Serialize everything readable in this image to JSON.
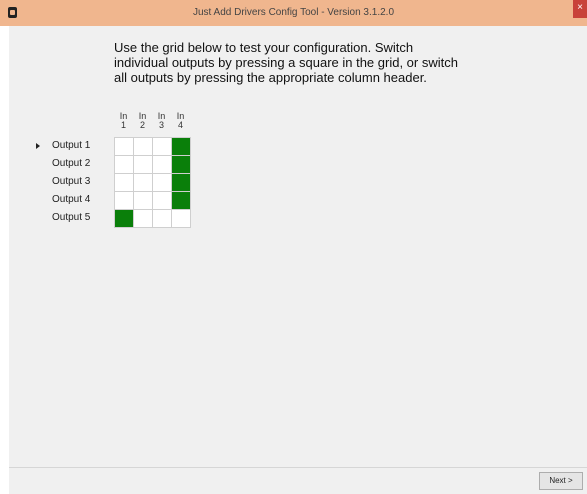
{
  "window": {
    "title": "Just Add Drivers Config Tool - Version 3.1.2.0",
    "close_glyph": "×"
  },
  "instructions": "Use the grid below to test your configuration. Switch\nindividual outputs by pressing a square in the grid, or switch\nall outputs by pressing the appropriate column header.",
  "grid": {
    "columns": [
      {
        "line1": "In",
        "line2": "1"
      },
      {
        "line1": "In",
        "line2": "2"
      },
      {
        "line1": "In",
        "line2": "3"
      },
      {
        "line1": "In",
        "line2": "4"
      }
    ],
    "rows": [
      {
        "label": "Output 1",
        "selected": true,
        "states": [
          false,
          false,
          false,
          true
        ]
      },
      {
        "label": "Output 2",
        "selected": false,
        "states": [
          false,
          false,
          false,
          true
        ]
      },
      {
        "label": "Output 3",
        "selected": false,
        "states": [
          false,
          false,
          false,
          true
        ]
      },
      {
        "label": "Output 4",
        "selected": false,
        "states": [
          false,
          false,
          false,
          true
        ]
      },
      {
        "label": "Output 5",
        "selected": false,
        "states": [
          true,
          false,
          false,
          false
        ]
      }
    ],
    "on_color": "#0a7f0a"
  },
  "footer": {
    "next_label": "Next >"
  }
}
